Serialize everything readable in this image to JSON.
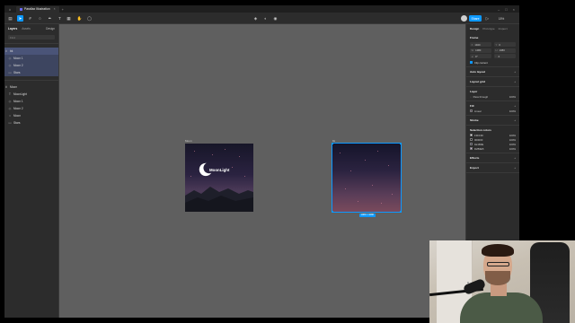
{
  "app": {
    "tab_title": "Parallax Illustration"
  },
  "left_panel": {
    "tabs": [
      "Layers",
      "Assets",
      "Design"
    ],
    "search_placeholder": "Find",
    "group1": {
      "label": "bk",
      "items": [
        "Moon 1",
        "Moon 2",
        "Stars"
      ]
    },
    "group2": {
      "label": "Moon",
      "items": [
        "MoonLight",
        "Moon 1",
        "Moon 2",
        "Moon",
        "Stars"
      ]
    }
  },
  "canvas": {
    "frame1_label": "Moon",
    "frame1_text": "MoonLight",
    "frame2_label": "bk",
    "selection_dims": "1080 × 1080"
  },
  "toolbar": {
    "share_label": "Share",
    "zoom": "18%"
  },
  "right_panel": {
    "tabs": [
      "Design",
      "Prototype",
      "Inspect"
    ],
    "frame": {
      "title": "Frame",
      "x": "1920",
      "y": "0",
      "w": "1080",
      "h": "1080",
      "rot": "0°",
      "radius": "0",
      "clip_content": "Clip content"
    },
    "auto_layout": "Auto layout",
    "layout_grid": "Layout grid",
    "layer": {
      "title": "Layer",
      "mode": "Pass through",
      "opacity": "100%"
    },
    "fill": {
      "title": "Fill",
      "type": "Linear",
      "opacity": "100%"
    },
    "stroke": "Stroke",
    "selection_colors": {
      "title": "Selection colors",
      "items": [
        {
          "hex": "FFFFFF",
          "pct": "100%",
          "color": "#ffffff"
        },
        {
          "hex": "000000",
          "pct": "100%",
          "color": "#000000"
        },
        {
          "hex": "1E1B3E",
          "pct": "100%",
          "color": "#1e1b3e"
        },
        {
          "hex": "D2B3E5",
          "pct": "100%",
          "color": "#d2b3e5"
        }
      ]
    },
    "effects": "Effects",
    "export": "Export"
  },
  "colors": {
    "accent": "#0d99ff",
    "canvas": "#5f5f5f",
    "panel": "#2c2c2c"
  }
}
